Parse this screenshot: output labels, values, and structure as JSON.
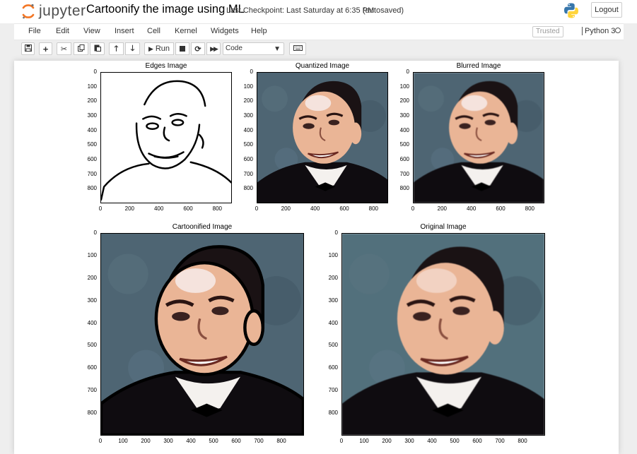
{
  "header": {
    "logo_text": "jupyter",
    "notebook_title": "Cartoonify the image using ML",
    "checkpoint": "Last Checkpoint: Last Saturday at 6:35 PM",
    "autosave": "(autosaved)",
    "logout_label": "Logout"
  },
  "menu": {
    "items": [
      "File",
      "Edit",
      "View",
      "Insert",
      "Cell",
      "Kernel",
      "Widgets",
      "Help"
    ],
    "trusted_label": "Trusted",
    "kernel_name": "Python 3"
  },
  "toolbar": {
    "run_label": "Run",
    "cell_type": "Code"
  },
  "figures": [
    {
      "title": "Edges Image",
      "kind": "edges",
      "yticks": [
        "0",
        "100",
        "200",
        "300",
        "400",
        "500",
        "600",
        "700",
        "800"
      ],
      "xticks": [
        "0",
        "200",
        "400",
        "600",
        "800"
      ]
    },
    {
      "title": "Quantized Image",
      "kind": "quantized",
      "yticks": [
        "0",
        "100",
        "200",
        "300",
        "400",
        "500",
        "600",
        "700",
        "800"
      ],
      "xticks": [
        "0",
        "200",
        "400",
        "600",
        "800"
      ]
    },
    {
      "title": "Blurred Image",
      "kind": "blurred",
      "yticks": [
        "0",
        "100",
        "200",
        "300",
        "400",
        "500",
        "600",
        "700",
        "800"
      ],
      "xticks": [
        "0",
        "200",
        "400",
        "600",
        "800"
      ]
    },
    {
      "title": "Cartoonified Image",
      "kind": "cartoon",
      "yticks": [
        "0",
        "100",
        "200",
        "300",
        "400",
        "500",
        "600",
        "700",
        "800"
      ],
      "xticks": [
        "0",
        "100",
        "200",
        "300",
        "400",
        "500",
        "600",
        "700",
        "800"
      ]
    },
    {
      "title": "Original Image",
      "kind": "original",
      "yticks": [
        "0",
        "100",
        "200",
        "300",
        "400",
        "500",
        "600",
        "700",
        "800"
      ],
      "xticks": [
        "0",
        "100",
        "200",
        "300",
        "400",
        "500",
        "600",
        "700",
        "800"
      ]
    }
  ],
  "colors": {
    "jupyter_orange": "#f37726",
    "background": "#4e6573",
    "skin": "#eab596",
    "hair": "#1a1214",
    "suit": "#0f0c10",
    "shirt": "#f4f1ee"
  }
}
